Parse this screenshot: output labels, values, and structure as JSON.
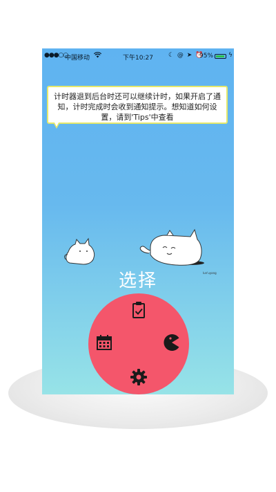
{
  "status_bar": {
    "signal": "●●●○○",
    "carrier": "中国移动",
    "wifi_icon": "wifi-icon",
    "time": "下午10:27",
    "icons": "☾ @ ➤ ⏰",
    "battery": "95%",
    "battery_level": 0.95
  },
  "tooltip": {
    "text": "计时器退到后台时还可以继续计时，如果开启了通知，计时完成时会收到通知提示。想知道如何设置，请到'Tips'中查看"
  },
  "title": "选择",
  "tiny_label": "lun'uyang",
  "menu": {
    "items": [
      "clipboard-icon",
      "calendar-icon",
      "pacman-icon",
      "settings-icon"
    ],
    "color": "#f4566b",
    "icon_color": "#1a1a1a"
  },
  "colors": {
    "background_top": "#5fb3f1",
    "background_bottom": "#97e3e7",
    "tooltip_border": "#e6e86a"
  }
}
